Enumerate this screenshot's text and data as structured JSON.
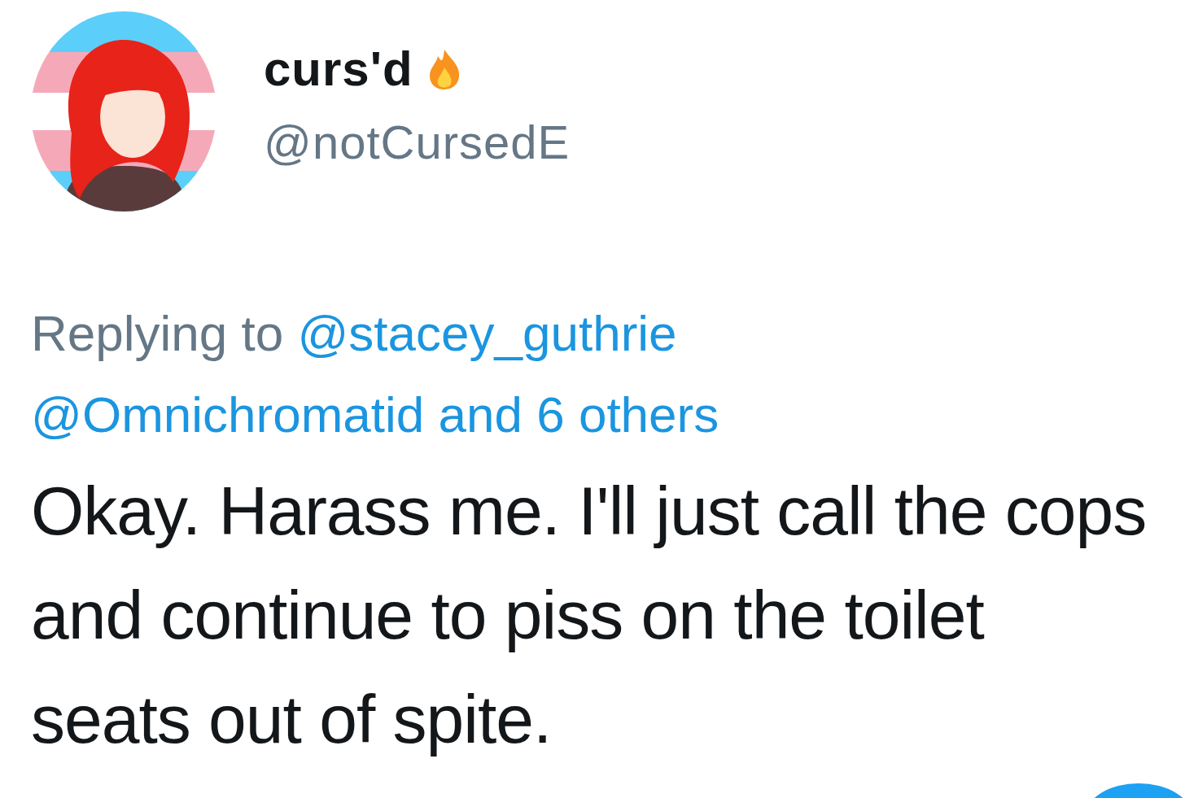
{
  "author": {
    "name": "curs'd",
    "handle": "@notCursedE"
  },
  "reply": {
    "prefix": "Replying to",
    "mentions": [
      "@stacey_guthrie",
      "@Omnichromatid"
    ],
    "others": "and 6 others"
  },
  "body": "Okay. Harass me. I'll just call the cops and continue to piss on the toilet seats out of spite."
}
